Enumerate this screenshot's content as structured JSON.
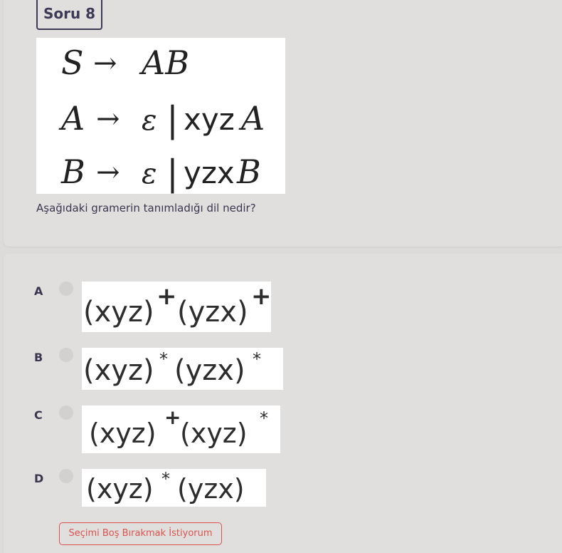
{
  "question": {
    "badge": "Soru 8",
    "text": "Aşağıdaki gramerin tanımladığı dil nedir?",
    "grammar": [
      {
        "lhs": "S",
        "arrow": "→",
        "rhs": "AB"
      },
      {
        "lhs": "A",
        "arrow": "→",
        "rhs_eps": "ε",
        "bar": "|",
        "rhs_str": "xyz",
        "rhs_var": "A"
      },
      {
        "lhs": "B",
        "arrow": "→",
        "rhs_eps": "ε",
        "bar": "|",
        "rhs_str": "yzx",
        "rhs_var": "B"
      }
    ]
  },
  "options": [
    {
      "letter": "A",
      "a": "(xyz)",
      "a_exp": "+",
      "b": "(yzx)",
      "b_exp": "+"
    },
    {
      "letter": "B",
      "a": "(xyz)",
      "a_exp": "*",
      "b": "(yzx)",
      "b_exp": "*"
    },
    {
      "letter": "C",
      "a": "(xyz)",
      "a_exp": "+",
      "b": "(xyz)",
      "b_exp": "*"
    },
    {
      "letter": "D",
      "a": "(xyz)",
      "a_exp": "*",
      "b": "(yzx)",
      "b_exp": ""
    }
  ],
  "skip_label": "Seçimi Boş Bırakmak İstiyorum"
}
